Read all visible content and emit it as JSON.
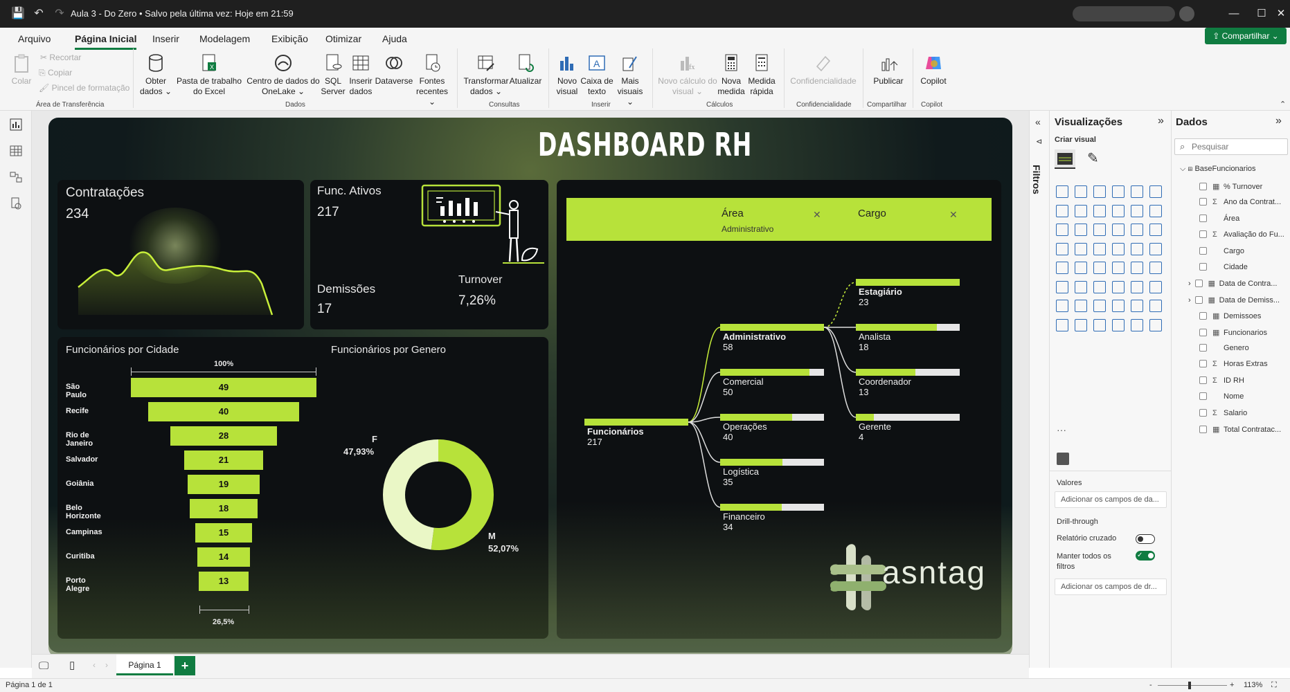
{
  "window": {
    "title": "Aula 3 - Do Zero • Salvo pela última vez: Hoje em 21:59"
  },
  "ribbon": {
    "tabs": [
      "Arquivo",
      "Página Inicial",
      "Inserir",
      "Modelagem",
      "Exibição",
      "Otimizar",
      "Ajuda"
    ],
    "share": "Compartilhar",
    "clipboard": {
      "paste": "Colar",
      "cut": "Recortar",
      "copy": "Copiar",
      "format_painter": "Pincel de formatação",
      "group": "Área de Transferência"
    },
    "data": {
      "get_data": "Obter dados",
      "excel": "Pasta de trabalho do Excel",
      "onelake": "Centro de dados do OneLake",
      "sql": "SQL Server",
      "enter": "Inserir dados",
      "dataverse": "Dataverse",
      "recent": "Fontes recentes",
      "group": "Dados"
    },
    "queries": {
      "transform": "Transformar dados",
      "refresh": "Atualizar",
      "group": "Consultas"
    },
    "insert": {
      "new_visual": "Novo visual",
      "textbox": "Caixa de texto",
      "more": "Mais visuais",
      "group": "Inserir"
    },
    "calc": {
      "new_calc": "Novo cálculo do visual",
      "new_measure": "Nova medida",
      "quick_measure": "Medida rápida",
      "group": "Cálculos"
    },
    "sens": {
      "label": "Confidencialidade",
      "group": "Confidencialidade"
    },
    "share_grp": {
      "publish": "Publicar",
      "group": "Compartilhar"
    },
    "copilot": {
      "label": "Copilot",
      "group": "Copilot"
    }
  },
  "dashboard": {
    "title": "DASHBOARD RH",
    "hires": {
      "label": "Contratações",
      "value": "234"
    },
    "active": {
      "label": "Func. Ativos",
      "value": "217"
    },
    "dismissals": {
      "label": "Demissões",
      "value": "17"
    },
    "turnover": {
      "label": "Turnover",
      "value": "7,26%"
    },
    "city_chart": {
      "title": "Funcionários por Cidade",
      "top_pct": "100%",
      "bottom_pct": "26,5%",
      "cities": [
        "São Paulo",
        "Recife",
        "Rio de Janeiro",
        "Salvador",
        "Goiânia",
        "Belo Horizonte",
        "Campinas",
        "Curitiba",
        "Porto Alegre"
      ],
      "values": [
        "49",
        "40",
        "28",
        "21",
        "19",
        "18",
        "15",
        "14",
        "13"
      ]
    },
    "gender_chart": {
      "title": "Funcionários por Genero",
      "f_label": "F",
      "f_value": "47,93%",
      "m_label": "M",
      "m_value": "52,07%",
      "f_share": 0.4793
    },
    "tree": {
      "header1": "Área",
      "header1_sel": "Administrativo",
      "header2": "Cargo",
      "root": {
        "label": "Funcionários",
        "value": "217"
      },
      "areas": [
        {
          "label": "Administrativo",
          "value": "58",
          "share": 1.0
        },
        {
          "label": "Comercial",
          "value": "50",
          "share": 0.86
        },
        {
          "label": "Operações",
          "value": "40",
          "share": 0.69
        },
        {
          "label": "Logística",
          "value": "35",
          "share": 0.6
        },
        {
          "label": "Financeiro",
          "value": "34",
          "share": 0.59
        }
      ],
      "roles": [
        {
          "label": "Estagiário",
          "value": "23",
          "share": 1.0
        },
        {
          "label": "Analista",
          "value": "18",
          "share": 0.78
        },
        {
          "label": "Coordenador",
          "value": "13",
          "share": 0.57
        },
        {
          "label": "Gerente",
          "value": "4",
          "share": 0.17
        }
      ]
    },
    "logo_text": "asntag"
  },
  "filters": {
    "label": "Filtros"
  },
  "viz": {
    "title": "Visualizações",
    "create": "Criar visual",
    "values": "Valores",
    "values_ph": "Adicionar os campos de da...",
    "drill": "Drill-through",
    "cross": "Relatório cruzado",
    "keep": "Manter todos os filtros",
    "drill_ph": "Adicionar os campos de dr..."
  },
  "data": {
    "title": "Dados",
    "search_ph": "Pesquisar",
    "table": "BaseFuncionarios",
    "fields": [
      {
        "label": "% Turnover",
        "type": "calc"
      },
      {
        "label": "Ano da Contrat...",
        "type": "sum"
      },
      {
        "label": "Área",
        "type": ""
      },
      {
        "label": "Avaliação do Fu...",
        "type": "sum"
      },
      {
        "label": "Cargo",
        "type": ""
      },
      {
        "label": "Cidade",
        "type": ""
      },
      {
        "label": "Data de Contra...",
        "type": "date"
      },
      {
        "label": "Data de Demiss...",
        "type": "date"
      },
      {
        "label": "Demissoes",
        "type": "calc"
      },
      {
        "label": "Funcionarios",
        "type": "calc"
      },
      {
        "label": "Genero",
        "type": ""
      },
      {
        "label": "Horas Extras",
        "type": "sum"
      },
      {
        "label": "ID RH",
        "type": "sum"
      },
      {
        "label": "Nome",
        "type": ""
      },
      {
        "label": "Salario",
        "type": "sum"
      },
      {
        "label": "Total Contratac...",
        "type": "calc"
      }
    ]
  },
  "pages": {
    "current": "Página 1",
    "add": "+"
  },
  "status": {
    "page": "Página 1 de 1",
    "zoom": "113%"
  },
  "colors": {
    "accent": "#b7e23a",
    "brand": "#107c41",
    "card": "#0d1012"
  }
}
